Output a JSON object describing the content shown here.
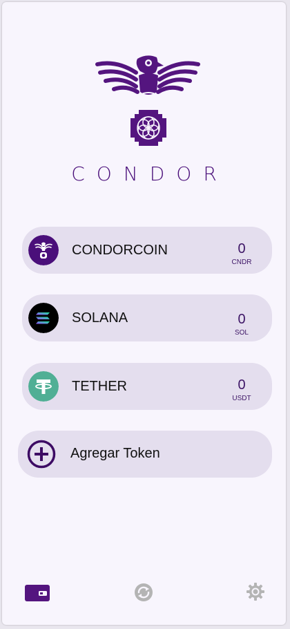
{
  "app": {
    "brand_name": "CONDOR",
    "logo_icon": "condor-bird-logo"
  },
  "tokens": [
    {
      "name": "CONDORCOIN",
      "balance": "0",
      "symbol": "CNDR",
      "icon": "condorcoin-icon"
    },
    {
      "name": "SOLANA",
      "balance": "0",
      "symbol": "SOL",
      "icon": "solana-icon"
    },
    {
      "name": "TETHER",
      "balance": "0",
      "symbol": "USDT",
      "icon": "tether-icon"
    }
  ],
  "add_token": {
    "label": "Agregar Token",
    "icon": "plus-circle-icon"
  },
  "bottom_nav": [
    {
      "id": "wallet",
      "icon": "wallet-icon",
      "active": true
    },
    {
      "id": "swap",
      "icon": "swap-icon",
      "active": false
    },
    {
      "id": "settings",
      "icon": "gear-icon",
      "active": false
    }
  ],
  "colors": {
    "primary": "#54157f",
    "background": "#f8f5fd",
    "card": "#e4deee",
    "tether": "#50af95",
    "inactive_icon": "#b4b4b4"
  }
}
